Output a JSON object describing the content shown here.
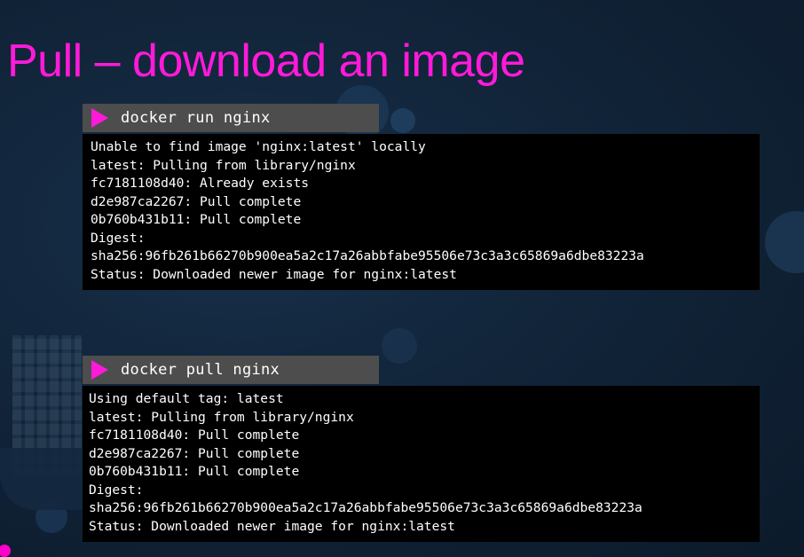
{
  "slide": {
    "title": "Pull – download an image"
  },
  "blocks": [
    {
      "command": "docker run nginx",
      "output": [
        "Unable to find image 'nginx:latest' locally",
        "latest: Pulling from library/nginx",
        "fc7181108d40: Already exists",
        "d2e987ca2267: Pull complete",
        "0b760b431b11: Pull complete",
        "Digest:",
        "sha256:96fb261b66270b900ea5a2c17a26abbfabe95506e73c3a3c65869a6dbe83223a",
        "Status: Downloaded newer image for nginx:latest"
      ]
    },
    {
      "command": "docker pull nginx",
      "output": [
        "Using default tag: latest",
        "latest: Pulling from library/nginx",
        "fc7181108d40: Pull complete",
        "d2e987ca2267: Pull complete",
        "0b760b431b11: Pull complete",
        "Digest:",
        "sha256:96fb261b66270b900ea5a2c17a26abbfabe95506e73c3a3c65869a6dbe83223a",
        "Status: Downloaded newer image for nginx:latest"
      ]
    }
  ],
  "icons": {
    "play": "play-icon"
  },
  "colors": {
    "accent": "#ff1ad9",
    "background": "#112439",
    "command_bar": "#4d4d4d",
    "terminal": "#000000",
    "text": "#ffffff"
  }
}
